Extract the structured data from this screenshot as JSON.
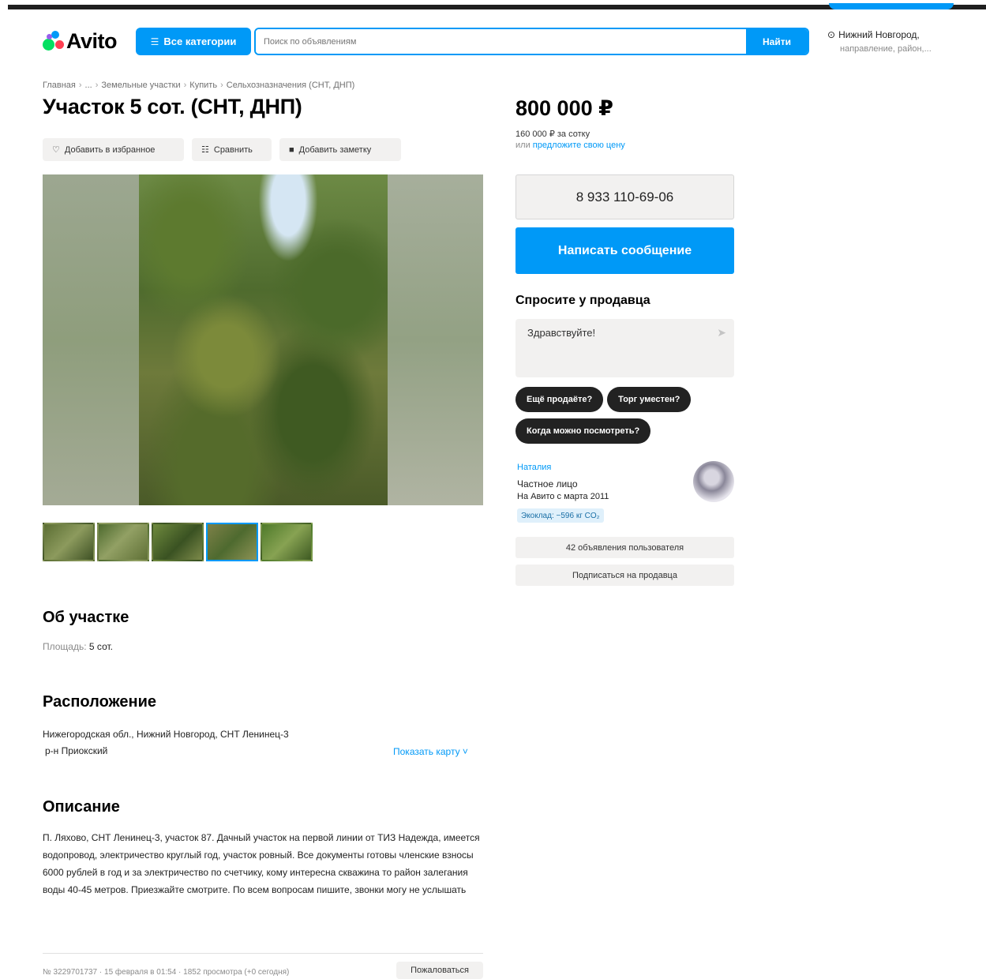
{
  "header": {
    "logo_text": "Avito",
    "categories_label": "Все категории",
    "search_placeholder": "Поиск по объявлениям",
    "search_button": "Найти",
    "location_city": "Нижний Новгород,",
    "location_sub": "направление, район,..."
  },
  "breadcrumb": [
    "Главная",
    "...",
    "Земельные участки",
    "Купить",
    "Сельхозназначения (СНТ, ДНП)"
  ],
  "listing": {
    "title": "Участок 5 сот. (СНТ, ДНП)",
    "actions": {
      "favorite": "Добавить в избранное",
      "compare": "Сравнить",
      "note": "Добавить заметку"
    },
    "thumb_count": 5,
    "active_thumb": 4
  },
  "about": {
    "heading": "Об участке",
    "area_label": "Площадь:",
    "area_value": "5 сот."
  },
  "location": {
    "heading": "Расположение",
    "address": "Нижегородская обл., Нижний Новгород, СНТ Ленинец-3",
    "district": "р-н Приокский",
    "show_map": "Показать карту ˅"
  },
  "description": {
    "heading": "Описание",
    "text": "П. Ляхово, СНТ Ленинец-3, участок 87. Дачный участок на первой линии от ТИЗ Надежда, имеется водопровод, электричество круглый год, участок ровный. Все документы готовы членские взносы 6000 рублей в год и за электричество по счетчику, кому интересна скважина то район залегания воды 40-45 метров. Приезжайте смотрите. По всем вопросам пишите, звонки могу не услышать"
  },
  "footer": {
    "meta": "№ 3229701737 · 15 февраля в 01:54 · 1852 просмотра (+0 сегодня)",
    "complain": "Пожаловаться"
  },
  "sidebar": {
    "price": "800 000 ₽",
    "price_per": "160 000 ₽ за сотку",
    "offer_prefix": "или",
    "offer_link": "предложите свою цену",
    "phone": "8 933 110-69-06",
    "message_button": "Написать сообщение",
    "ask_heading": "Спросите у продавца",
    "ask_placeholder": "Здравствуйте!",
    "chips": [
      "Ещё продаёте?",
      "Торг уместен?",
      "Когда можно посмотреть?"
    ],
    "seller_name": "Наталия",
    "seller_type": "Частное лицо",
    "seller_since": "На Авито с марта 2011",
    "eco": "Экоклад: −596 кг CO₂",
    "ads_button": "42 объявления пользователя",
    "subscribe_button": "Подписаться на продавца"
  }
}
